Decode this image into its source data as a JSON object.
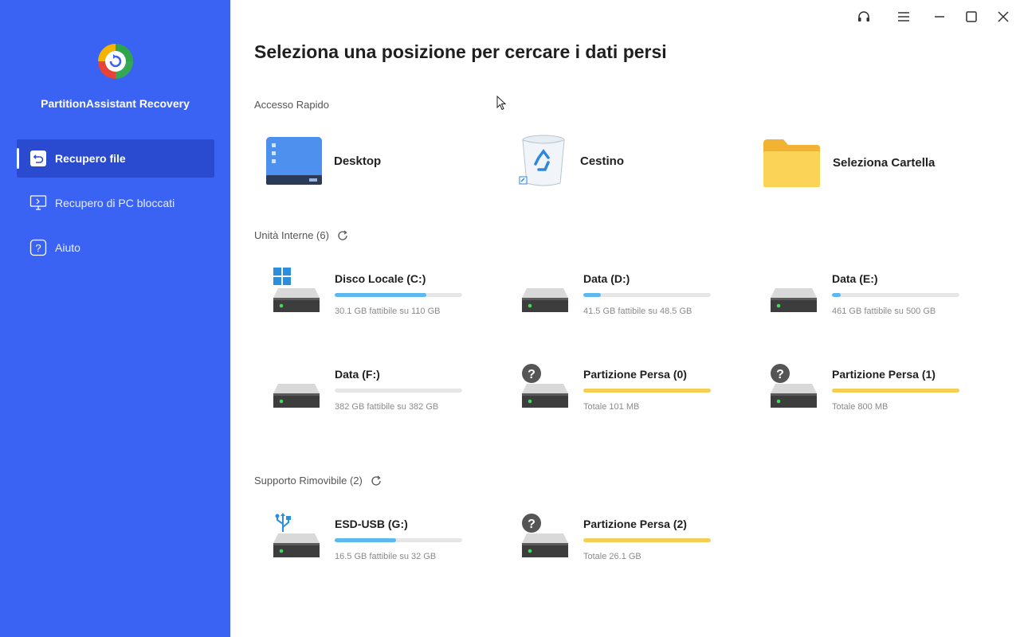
{
  "app": {
    "name": "PartitionAssistant Recovery"
  },
  "sidebar": {
    "items": [
      {
        "label": "Recupero file",
        "icon": "file-restore-icon",
        "active": true
      },
      {
        "label": "Recupero di PC bloccati",
        "icon": "monitor-icon",
        "active": false
      },
      {
        "label": "Aiuto",
        "icon": "help-icon",
        "active": false
      }
    ]
  },
  "window_controls": [
    "headset-icon",
    "menu-icon",
    "minimize-icon",
    "maximize-icon",
    "close-icon"
  ],
  "main": {
    "title": "Seleziona una posizione per cercare i dati persi",
    "quick_access": {
      "label": "Accesso Rapido",
      "items": [
        {
          "label": "Desktop",
          "icon": "desktop-icon"
        },
        {
          "label": "Cestino",
          "icon": "recycle-bin-icon"
        },
        {
          "label": "Seleziona Cartella",
          "icon": "folder-icon"
        }
      ]
    },
    "internal": {
      "label": "Unità Interne (6)",
      "drives": [
        {
          "name": "Disco Locale (C:)",
          "size": "30.1 GB fattibile su 110 GB",
          "fill": 0.72,
          "color": "#5cb8f0",
          "badge": "windows"
        },
        {
          "name": "Data (D:)",
          "size": "41.5 GB fattibile su 48.5 GB",
          "fill": 0.14,
          "color": "#5cb8f0",
          "badge": ""
        },
        {
          "name": "Data (E:)",
          "size": "461 GB fattibile su 500 GB",
          "fill": 0.07,
          "color": "#5cb8f0",
          "badge": ""
        },
        {
          "name": "Data (F:)",
          "size": "382 GB fattibile su 382 GB",
          "fill": 0.0,
          "color": "#5cb8f0",
          "badge": ""
        },
        {
          "name": "Partizione Persa (0)",
          "size": "Totale 101 MB",
          "fill": 1.0,
          "color": "#f5cf55",
          "badge": "question"
        },
        {
          "name": "Partizione Persa (1)",
          "size": "Totale 800 MB",
          "fill": 1.0,
          "color": "#f5cf55",
          "badge": "question"
        }
      ]
    },
    "removable": {
      "label": "Supporto Rimovibile (2)",
      "drives": [
        {
          "name": "ESD-USB (G:)",
          "size": "16.5 GB fattibile su 32 GB",
          "fill": 0.48,
          "color": "#5cb8f0",
          "badge": "usb"
        },
        {
          "name": "Partizione Persa (2)",
          "size": "Totale 26.1 GB",
          "fill": 1.0,
          "color": "#f5cf55",
          "badge": "question"
        }
      ]
    }
  }
}
